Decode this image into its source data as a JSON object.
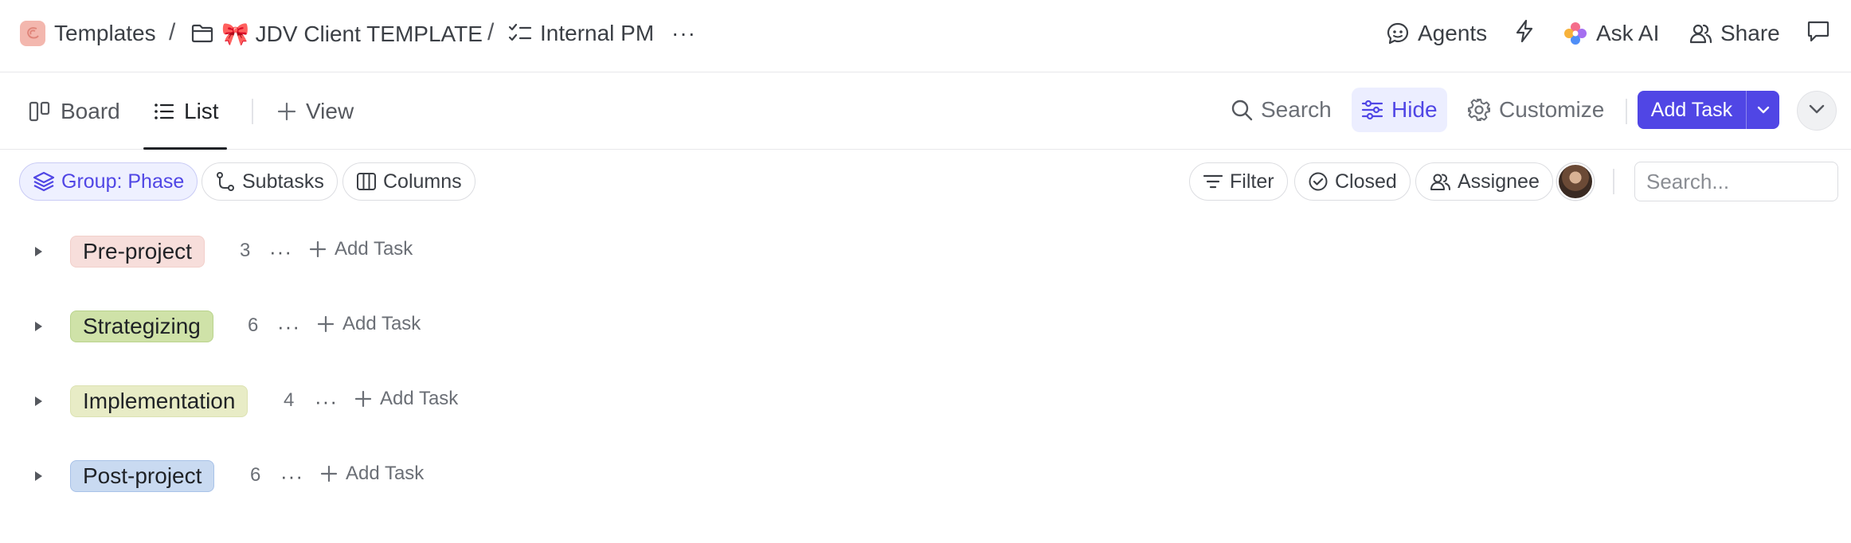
{
  "breadcrumb": {
    "items": [
      {
        "label": "Templates",
        "icon": "templates-icon"
      },
      {
        "label": "🎀 JDV Client TEMPLATE",
        "icon": "folder-icon"
      },
      {
        "label": "Internal PM",
        "icon": "checklist-icon"
      }
    ],
    "separator": "/",
    "more": "···"
  },
  "topbar": {
    "agents_label": "Agents",
    "ask_ai_label": "Ask AI",
    "share_label": "Share"
  },
  "views": {
    "tabs": [
      {
        "label": "Board",
        "icon": "board-icon",
        "active": false
      },
      {
        "label": "List",
        "icon": "list-icon",
        "active": true
      }
    ],
    "add_view_label": "View",
    "search_label": "Search",
    "hide_label": "Hide",
    "customize_label": "Customize",
    "add_task_label": "Add Task"
  },
  "filters": {
    "group_label": "Group: Phase",
    "subtasks_label": "Subtasks",
    "columns_label": "Columns",
    "filter_label": "Filter",
    "closed_label": "Closed",
    "assignee_label": "Assignee",
    "search_placeholder": "Search..."
  },
  "groups": [
    {
      "name": "Pre-project",
      "count": "3",
      "color": "#f7dedb",
      "border": "#f2cfca",
      "add_label": "Add Task"
    },
    {
      "name": "Strategizing",
      "count": "6",
      "color": "#cfe2a8",
      "border": "#b9d38c",
      "add_label": "Add Task"
    },
    {
      "name": "Implementation",
      "count": "4",
      "color": "#e8ecc6",
      "border": "#dce2b2",
      "add_label": "Add Task"
    },
    {
      "name": "Post-project",
      "count": "6",
      "color": "#c9daf1",
      "border": "#a8c2e8",
      "add_label": "Add Task"
    }
  ],
  "colors": {
    "accent": "#5046e5",
    "hide_bg": "#eceeff"
  }
}
